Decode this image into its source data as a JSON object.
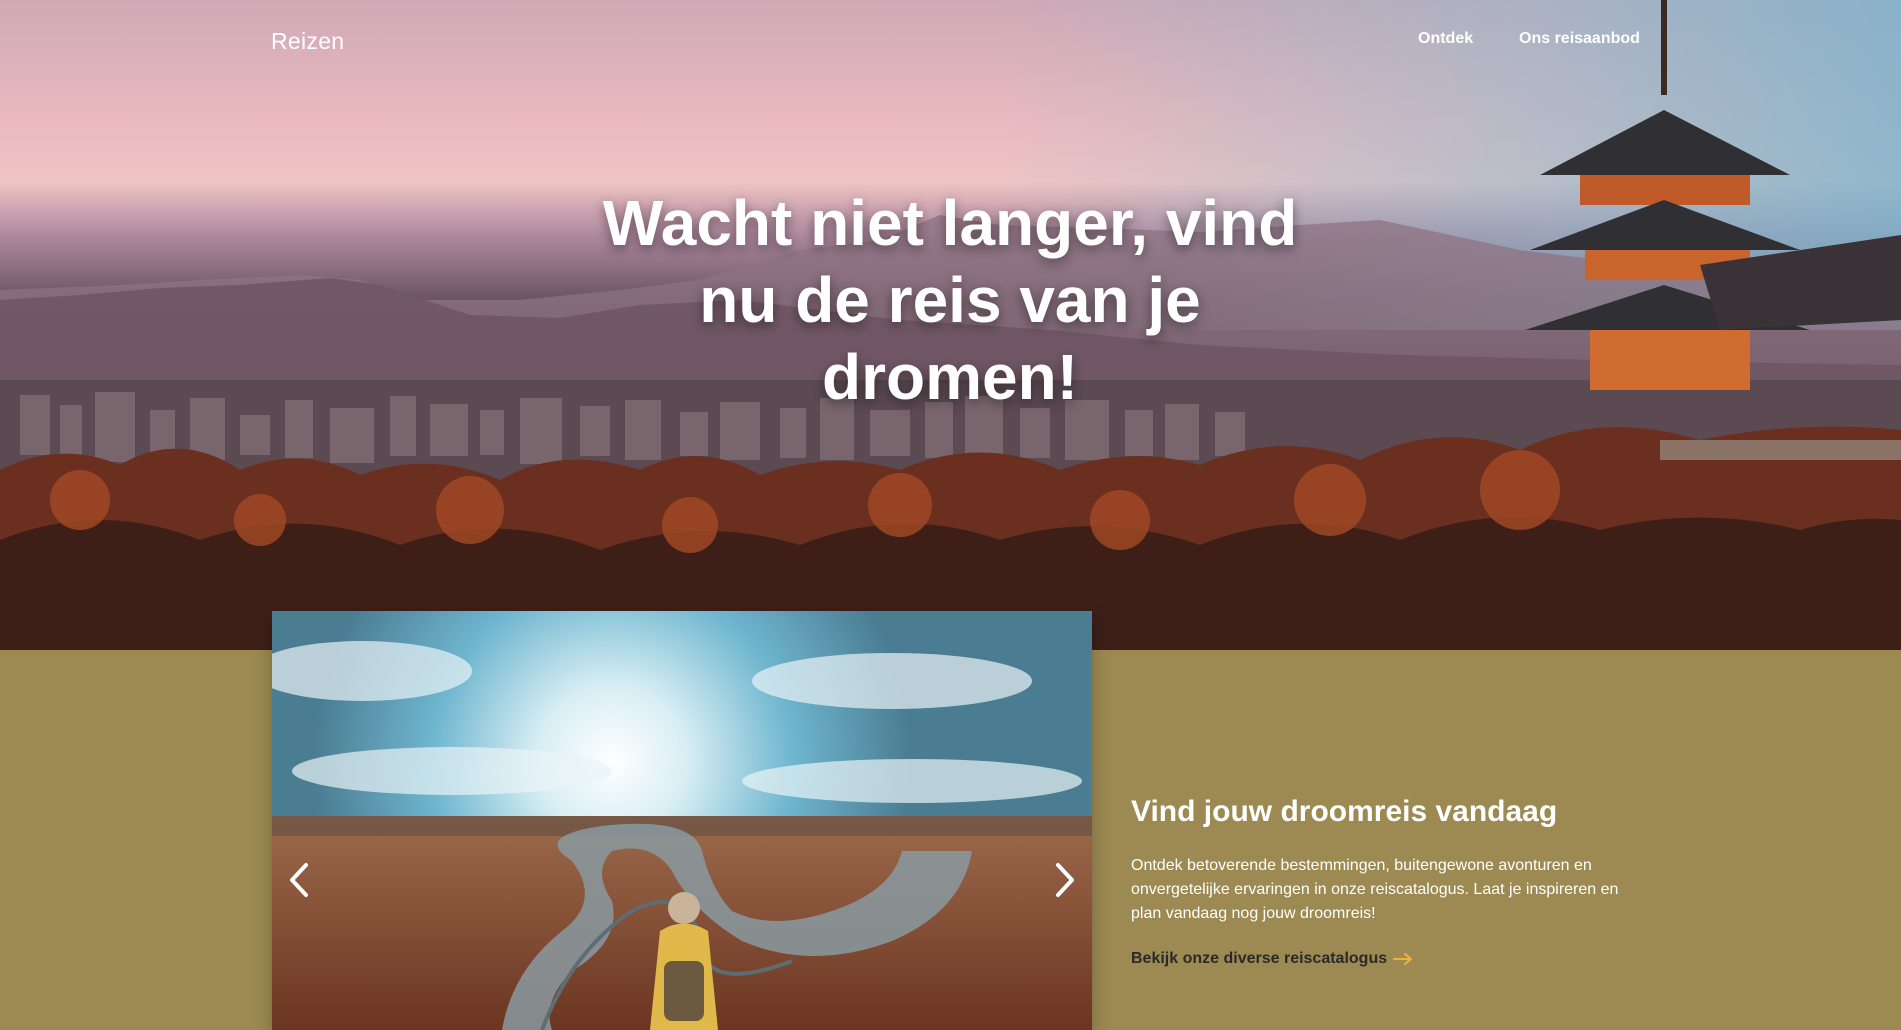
{
  "header": {
    "brand": "Reizen",
    "nav": [
      {
        "label": "Ontdek"
      },
      {
        "label": "Ons reisaanbod"
      }
    ]
  },
  "hero": {
    "headline": "Wacht niet langer, vind nu de reis van je dromen!"
  },
  "feature": {
    "title": "Vind jouw droomreis vandaag",
    "text": "Ontdek betoverende bestemmingen, buitengewone avonturen en onvergetelijke ervaringen in onze reiscatalogus. Laat je inspireren en plan vandaag nog jouw droomreis!",
    "link_label": "Bekijk onze diverse reiscatalogus",
    "link_icon": "arrow-right-icon"
  },
  "carousel": {
    "prev_icon": "chevron-left-icon",
    "next_icon": "chevron-right-icon"
  },
  "colors": {
    "section_bg": "#9c8a52",
    "link_arrow": "#f0b040",
    "text_light": "#ffffff",
    "link_text": "#2a2a2a"
  }
}
